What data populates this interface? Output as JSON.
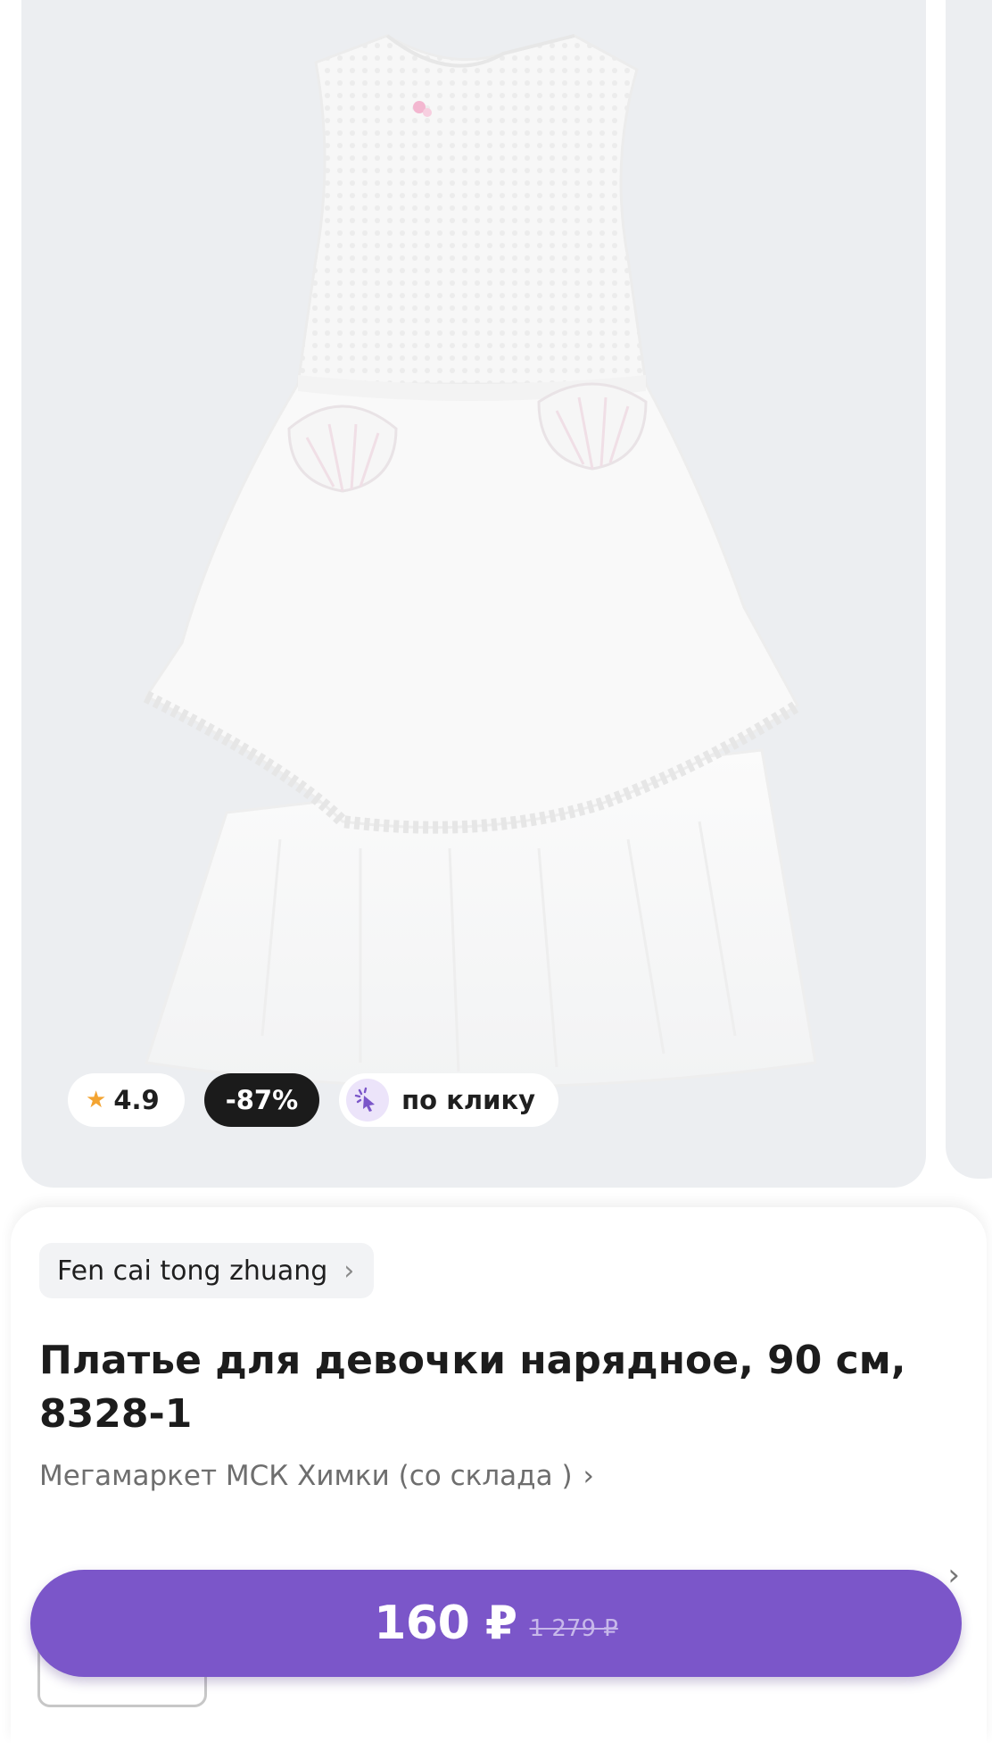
{
  "product": {
    "rating": "4.9",
    "discount": "-87%",
    "click_label": "по клику",
    "brand": "Fen cai tong zhuang",
    "title": "Платье для девочки нарядное, 90 см, 8328-1",
    "seller": "Мегамаркет МСК Химки (со склада )",
    "price": "160 ₽",
    "old_price": "1 279 ₽"
  },
  "icons": {
    "rating": "star-icon",
    "click": "click-cursor-icon",
    "brand_chevron": "chevron-right-icon",
    "seller_chevron": "chevron-right-icon"
  },
  "colors": {
    "accent": "#7b56c9",
    "star": "#f3a431",
    "discount_badge": "#1b1b1b",
    "image_background": "#eceef1"
  }
}
